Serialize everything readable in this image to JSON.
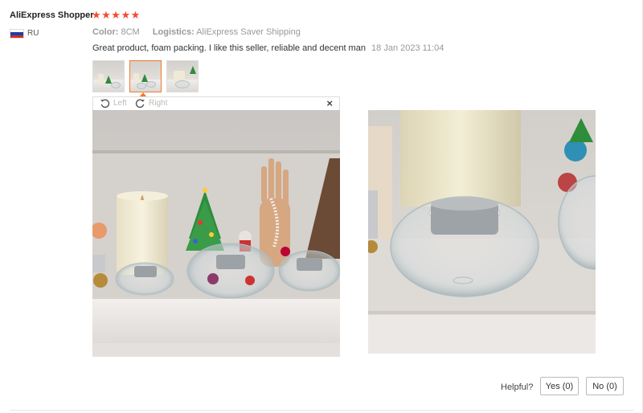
{
  "review": {
    "reviewer_name": "AliExpress Shopper",
    "rating_stars": "★★★★★",
    "rating": 5,
    "country_code": "RU",
    "color_label": "Color:",
    "color_value": "8CM",
    "logistics_label": "Logistics:",
    "logistics_value": "AliExpress Saver Shipping",
    "text": "Great product, foam packing. I like this seller, reliable and decent man",
    "date": "18 Jan 2023 11:04"
  },
  "viewer": {
    "rotate_left_label": "Left",
    "rotate_right_label": "Right",
    "close_glyph": "×",
    "selected_thumbnail_index": 2
  },
  "thumbnails": [
    {
      "icon": "photo-thumbnail-1"
    },
    {
      "icon": "photo-thumbnail-2"
    },
    {
      "icon": "photo-thumbnail-3"
    }
  ],
  "feedback": {
    "helpful_label": "Helpful?",
    "yes_label": "Yes (0)",
    "no_label": "No (0)"
  },
  "colors": {
    "star": "#f44b2f",
    "accent": "#f17a2a",
    "flag_white": "#ffffff",
    "flag_blue": "#1c3fa8",
    "flag_red": "#d52b1e"
  }
}
